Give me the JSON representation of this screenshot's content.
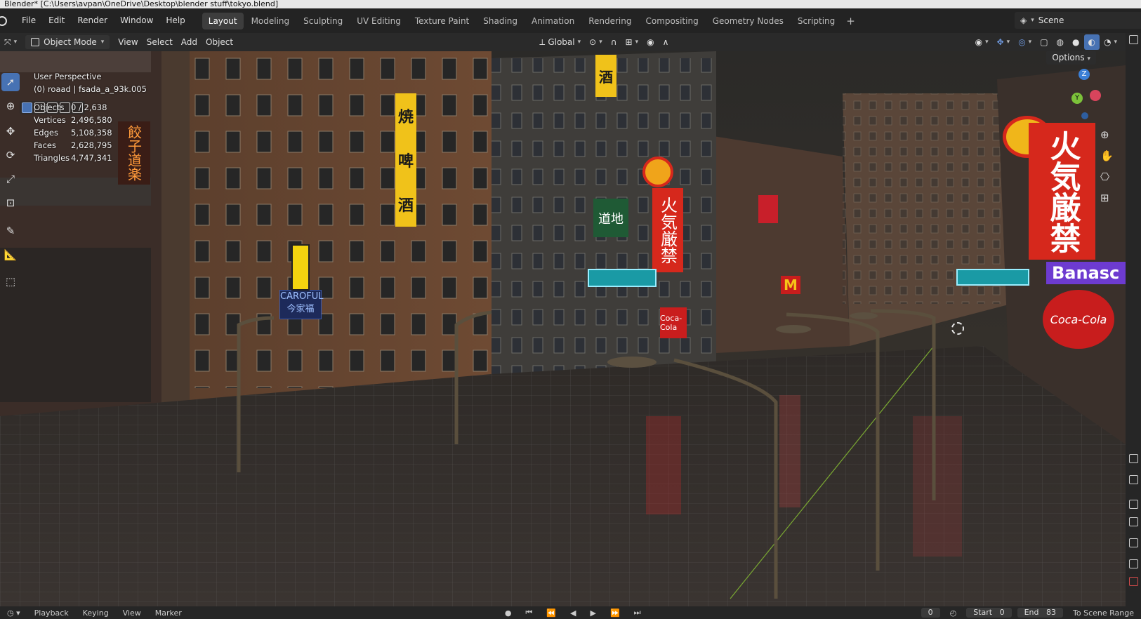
{
  "title_bar": "Blender* [C:\\Users\\avpan\\OneDrive\\Desktop\\blender stuff\\tokyo.blend]",
  "menu": [
    "File",
    "Edit",
    "Render",
    "Window",
    "Help"
  ],
  "workspaces": [
    "Layout",
    "Modeling",
    "Sculpting",
    "UV Editing",
    "Texture Paint",
    "Shading",
    "Animation",
    "Rendering",
    "Compositing",
    "Geometry Nodes",
    "Scripting"
  ],
  "active_workspace": "Layout",
  "scene_name": "Scene",
  "header": {
    "mode": "Object Mode",
    "menus": [
      "View",
      "Select",
      "Add",
      "Object"
    ],
    "orientation": "Global",
    "options": "Options"
  },
  "viewport": {
    "view_name": "User Perspective",
    "active_info": "(0) roaad | fsada_a_93k.005",
    "stats": [
      {
        "label": "Objects",
        "value": "0 / 2,638"
      },
      {
        "label": "Vertices",
        "value": "2,496,580"
      },
      {
        "label": "Edges",
        "value": "5,108,358"
      },
      {
        "label": "Faces",
        "value": "2,628,795"
      },
      {
        "label": "Triangles",
        "value": "4,747,341"
      }
    ],
    "signs": {
      "carrefour_en": "CAROFUL",
      "carrefour_cn": "今家福",
      "banner_right": "Banasc",
      "kanji_big": "火気厳禁",
      "kanji_mid": "火気厳禁",
      "yakitori": "焼",
      "beer": "啤",
      "sake": "酒",
      "michi": "道地",
      "left_sign": "餃子道楽",
      "coca": "Coca-Cola"
    }
  },
  "timeline": {
    "playback": "Playback",
    "keying": "Keying",
    "view": "View",
    "marker": "Marker",
    "current_frame": "0",
    "start_label": "Start",
    "start": "0",
    "end_label": "End",
    "end": "83",
    "to_scene_range": "To Scene Range"
  },
  "colors": {
    "accent": "#4772b3",
    "header_bg": "#2a2a2a",
    "topbar_bg": "#232323"
  }
}
